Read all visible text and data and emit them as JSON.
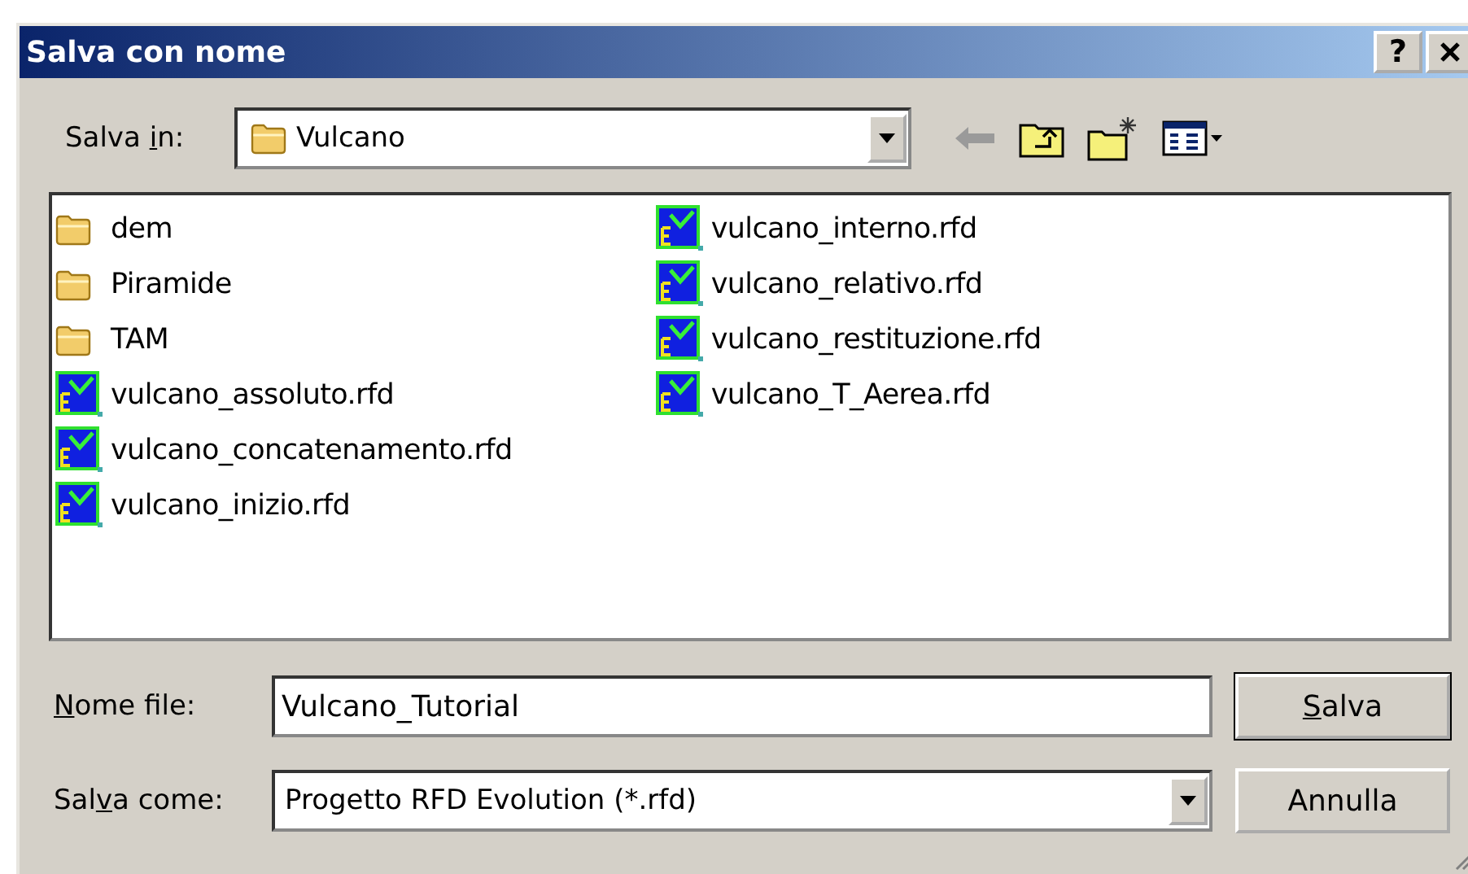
{
  "window": {
    "title": "Salva con nome",
    "help": "?"
  },
  "location": {
    "label": {
      "before": "Salva ",
      "key": "i",
      "after": "n:"
    },
    "value": "Vulcano"
  },
  "files": [
    {
      "name": "dem",
      "kind": "folder"
    },
    {
      "name": "Piramide",
      "kind": "folder"
    },
    {
      "name": "TAM",
      "kind": "folder"
    },
    {
      "name": "vulcano_assoluto.rfd",
      "kind": "rfd"
    },
    {
      "name": "vulcano_concatenamento.rfd",
      "kind": "rfd"
    },
    {
      "name": "vulcano_inizio.rfd",
      "kind": "rfd"
    },
    {
      "name": "vulcano_interno.rfd",
      "kind": "rfd"
    },
    {
      "name": "vulcano_relativo.rfd",
      "kind": "rfd"
    },
    {
      "name": "vulcano_restituzione.rfd",
      "kind": "rfd"
    },
    {
      "name": "vulcano_T_Aerea.rfd",
      "kind": "rfd"
    }
  ],
  "file_name": {
    "label": {
      "key": "N",
      "after": "ome file:"
    },
    "value": "Vulcano_Tutorial"
  },
  "save_as": {
    "label": {
      "before": "Sal",
      "key": "v",
      "after": "a come:"
    },
    "value": "Progetto RFD Evolution (*.rfd)"
  },
  "buttons": [
    {
      "label": {
        "key": "S",
        "after": "alva"
      },
      "default": true
    },
    {
      "label": {
        "before": "Annulla"
      },
      "default": false
    }
  ]
}
